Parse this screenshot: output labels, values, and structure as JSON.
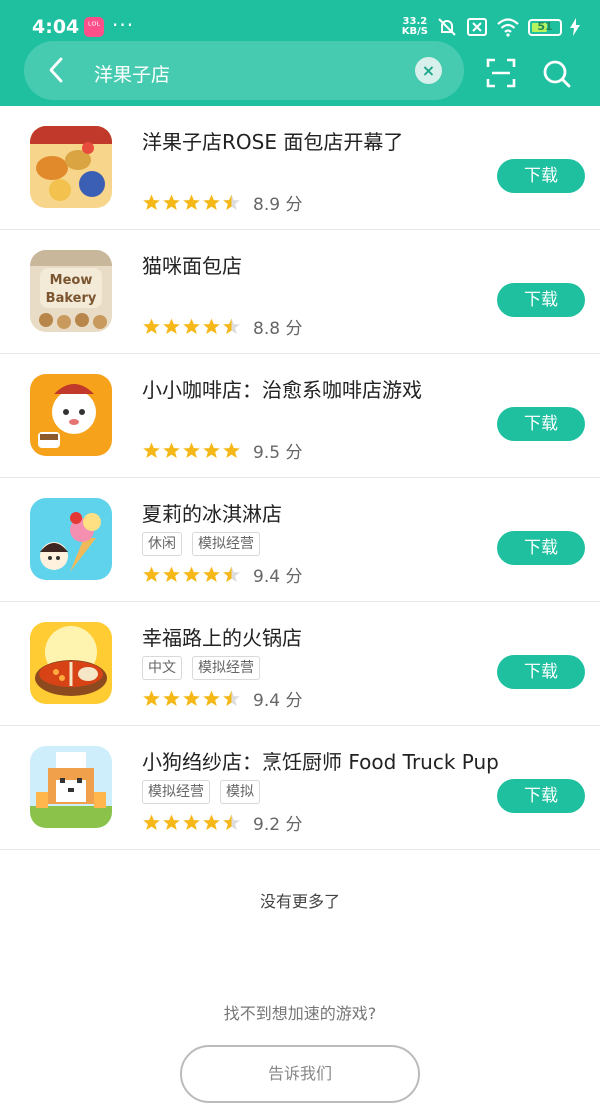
{
  "status_bar": {
    "time": "4:04",
    "app_badge": "ᴸᴼᴸ",
    "dots": "···",
    "net_speed_value": "33.2",
    "net_speed_unit": "KB/S",
    "battery": "51"
  },
  "search": {
    "query": "洋果子店"
  },
  "icons": {
    "back": "chevron-left-icon",
    "clear": "clear-icon",
    "scan": "scan-icon",
    "search": "search-icon",
    "star": "star-icon"
  },
  "colors": {
    "brand": "#1ec0a0",
    "star": "#f5b818"
  },
  "results": [
    {
      "title": "洋果子店ROSE 面包店开幕了",
      "tags": [],
      "rating": 4.5,
      "score": "8.9 分",
      "download_label": "下载"
    },
    {
      "title": "猫咪面包店",
      "tags": [],
      "rating": 4.5,
      "score": "8.8 分",
      "download_label": "下载"
    },
    {
      "title": "小小咖啡店：治愈系咖啡店游戏",
      "tags": [],
      "rating": 5,
      "score": "9.5 分",
      "download_label": "下载"
    },
    {
      "title": "夏莉的冰淇淋店",
      "tags": [
        "休闲",
        "模拟经营"
      ],
      "rating": 4.5,
      "score": "9.4 分",
      "download_label": "下载"
    },
    {
      "title": "幸福路上的火锅店",
      "tags": [
        "中文",
        "模拟经营"
      ],
      "rating": 4.5,
      "score": "9.4 分",
      "download_label": "下载"
    },
    {
      "title": "小狗绉纱店：烹饪厨师 Food Truck Pup",
      "tags": [
        "模拟经营",
        "模拟"
      ],
      "rating": 4.5,
      "score": "9.2 分",
      "download_label": "下载"
    }
  ],
  "footer": {
    "no_more": "没有更多了",
    "cannot_find": "找不到想加速的游戏?",
    "tell_us": "告诉我们"
  }
}
